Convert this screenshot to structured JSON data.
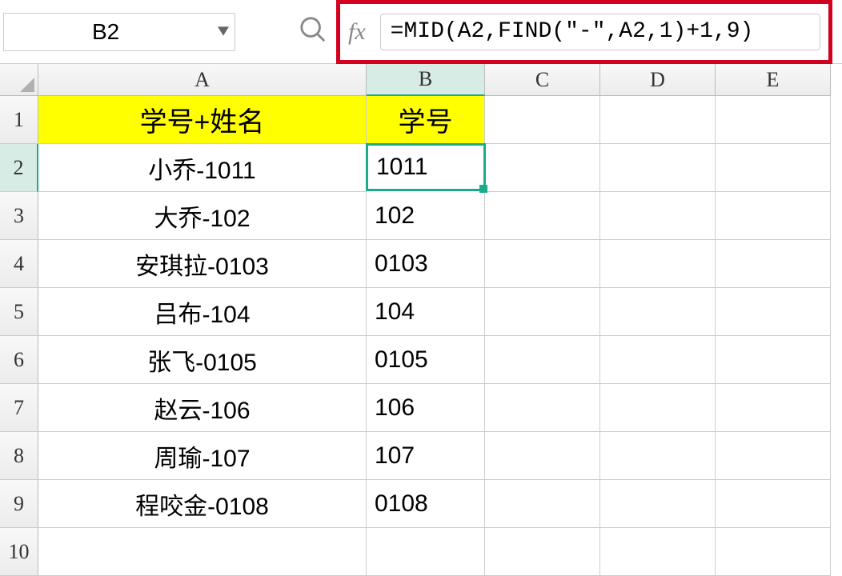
{
  "toolbar": {
    "name_box_value": "B2",
    "fx_label": "fx",
    "formula": "=MID(A2,FIND(\"-\",A2,1)+1,9)"
  },
  "columns": [
    "A",
    "B",
    "C",
    "D",
    "E"
  ],
  "active_column_index": 1,
  "row_headers": [
    "1",
    "2",
    "3",
    "4",
    "5",
    "6",
    "7",
    "8",
    "9",
    "10"
  ],
  "active_row_index": 1,
  "headers": {
    "A": "学号+姓名",
    "B": "学号"
  },
  "selected_cell": "B2",
  "rows": [
    {
      "A": "小乔-1011",
      "B": "1011"
    },
    {
      "A": "大乔-102",
      "B": "102"
    },
    {
      "A": "安琪拉-0103",
      "B": "0103"
    },
    {
      "A": "吕布-104",
      "B": "104"
    },
    {
      "A": "张飞-0105",
      "B": "0105"
    },
    {
      "A": "赵云-106",
      "B": "106"
    },
    {
      "A": "周瑜-107",
      "B": "107"
    },
    {
      "A": "程咬金-0108",
      "B": "0108"
    }
  ]
}
